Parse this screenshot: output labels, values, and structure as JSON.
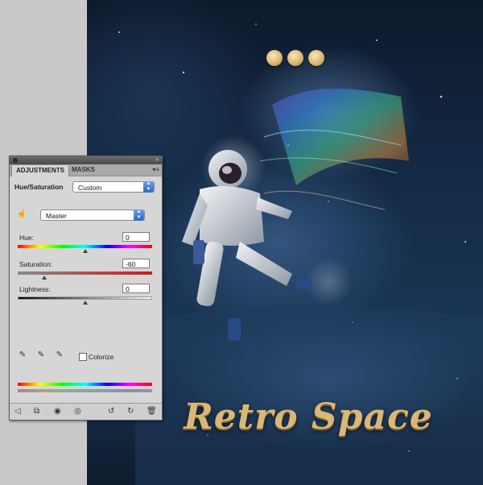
{
  "artwork": {
    "title": "Retro Space"
  },
  "panel": {
    "tabs": {
      "active": "ADJUSTMENTS",
      "inactive": "MASKS"
    },
    "adjustment_name": "Hue/Saturation",
    "preset": "Custom",
    "channel": "Master",
    "hue": {
      "label": "Hue:",
      "value": "0",
      "slider_fraction": 0.5
    },
    "saturation": {
      "label": "Saturation:",
      "value": "-60",
      "slider_fraction": 0.2
    },
    "lightness": {
      "label": "Lightness:",
      "value": "0",
      "slider_fraction": 0.5
    },
    "colorize": {
      "label": "Colorize",
      "checked": false
    },
    "icons": {
      "targeted_adjustment": "hand-target-icon",
      "eyedroppers": [
        "eyedropper-icon",
        "eyedropper-plus-icon",
        "eyedropper-minus-icon"
      ],
      "bottom": [
        "back-arrow-icon",
        "expand-view-icon",
        "clip-layer-icon",
        "visibility-eye-icon",
        "previous-state-icon",
        "reset-icon",
        "trash-icon"
      ]
    }
  }
}
